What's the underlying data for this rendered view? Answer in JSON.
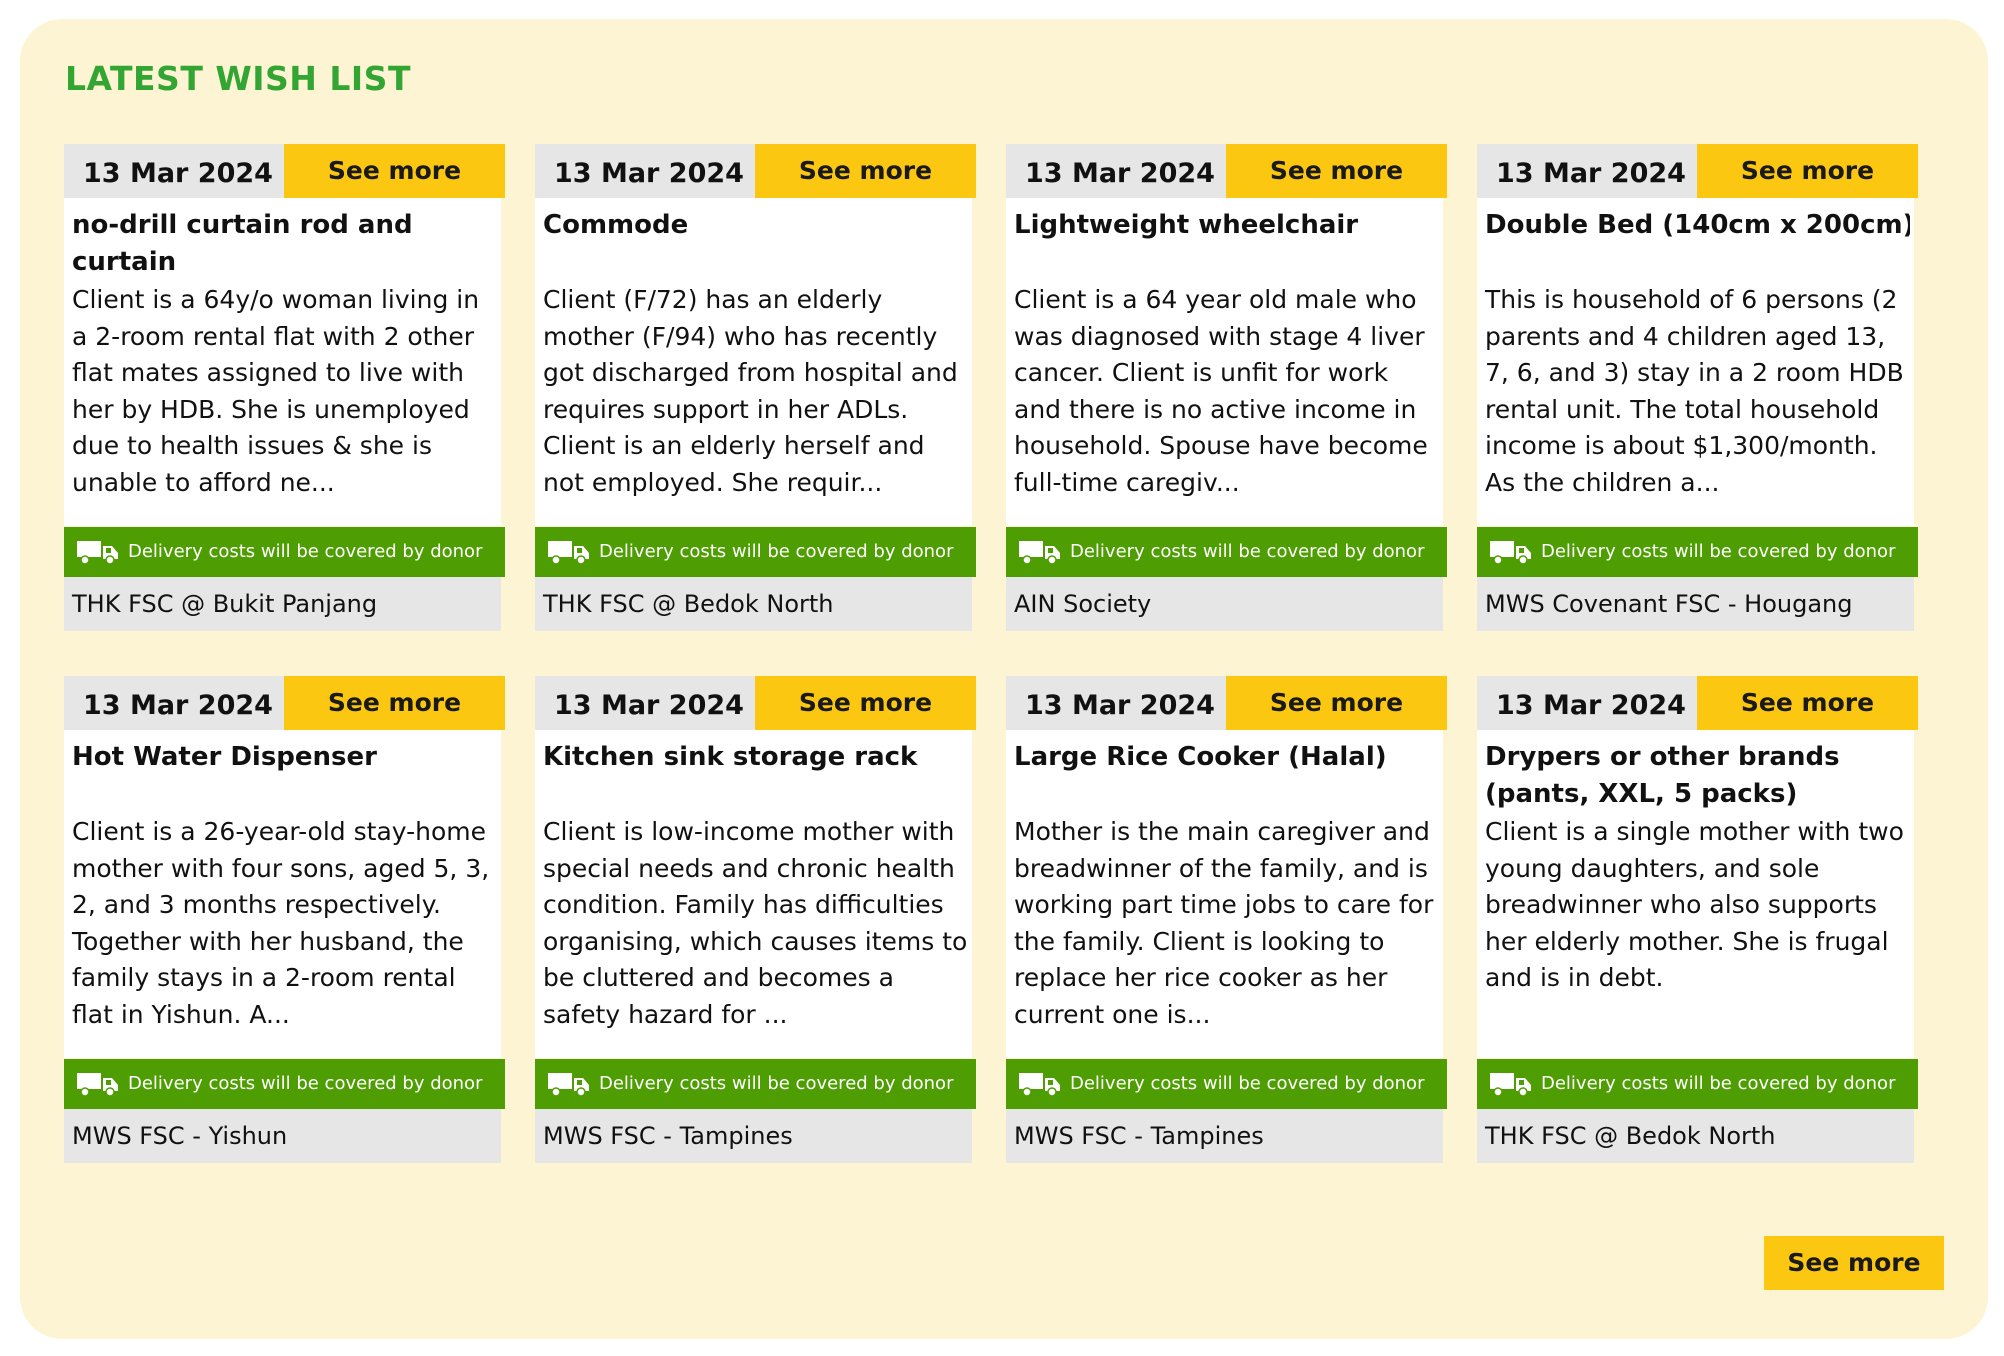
{
  "section": {
    "title": "LATEST WISH LIST",
    "see_more_label": "See more"
  },
  "colors": {
    "title_green": "#33a532",
    "panel_bg": "#fdf4d4",
    "button_yellow": "#fcc710",
    "delivery_green": "#4e9e03",
    "card_grey": "#e6e6e6"
  },
  "delivery_text": "Delivery costs will be covered by donor",
  "cards": [
    {
      "date": "13 Mar 2024",
      "see_more": "See more",
      "name": "no-drill curtain rod and curtain",
      "description": "Client is a 64y/o woman living in a 2-room rental flat with 2 other flat mates assigned to live with her by HDB. She is unemployed due to health issues & she is unable to afford ne...",
      "delivery": "Delivery costs will be covered by donor",
      "org": "THK FSC @ Bukit Panjang"
    },
    {
      "date": "13 Mar 2024",
      "see_more": "See more",
      "name": "Commode",
      "description": "Client (F/72) has an elderly mother (F/94) who has recently got discharged from hospital and requires support in her ADLs. Client is an elderly herself and not employed. She requir...",
      "delivery": "Delivery costs will be covered by donor",
      "org": "THK FSC @ Bedok North"
    },
    {
      "date": "13 Mar 2024",
      "see_more": "See more",
      "name": "Lightweight wheelchair",
      "description": "Client is a 64 year old male who was diagnosed with stage 4 liver cancer. Client is unfit for work and there is no active income in household. Spouse have become full-time caregiv...",
      "delivery": "Delivery costs will be covered by donor",
      "org": "AIN Society"
    },
    {
      "date": "13 Mar 2024",
      "see_more": "See more",
      "name": "Double Bed (140cm x 200cm)",
      "description": "This is household of 6 persons (2 parents and 4 children aged 13, 7, 6, and 3) stay in a 2 room HDB rental unit. The total household income is about $1,300/month. As the children a...",
      "delivery": "Delivery costs will be covered by donor",
      "org": "MWS Covenant FSC - Hougang"
    },
    {
      "date": "13 Mar 2024",
      "see_more": "See more",
      "name": "Hot Water Dispenser",
      "description": "Client is a 26-year-old stay-home mother with four sons, aged 5, 3, 2, and 3 months respectively. Together with her husband, the family stays in a 2-room rental flat in Yishun. A...",
      "delivery": "Delivery costs will be covered by donor",
      "org": "MWS FSC - Yishun"
    },
    {
      "date": "13 Mar 2024",
      "see_more": "See more",
      "name": "Kitchen sink storage rack",
      "description": "Client is low-income mother with special needs and chronic health condition. Family has difficulties organising, which causes items to be cluttered and becomes a safety hazard for ...",
      "delivery": "Delivery costs will be covered by donor",
      "org": "MWS FSC - Tampines"
    },
    {
      "date": "13 Mar 2024",
      "see_more": "See more",
      "name": "Large Rice Cooker (Halal)",
      "description": "Mother is the main caregiver and breadwinner of the family, and is working part time jobs to care for the family. Client is looking to replace her rice cooker as her current one is...",
      "delivery": "Delivery costs will be covered by donor",
      "org": "MWS FSC - Tampines"
    },
    {
      "date": "13 Mar 2024",
      "see_more": "See more",
      "name": "Drypers or other brands (pants, XXL, 5 packs)",
      "description": "Client is a single mother with two young daughters, and sole breadwinner who also supports her elderly mother. She is frugal and is in debt.",
      "delivery": "Delivery costs will be covered by donor",
      "org": "THK FSC @ Bedok North"
    }
  ]
}
